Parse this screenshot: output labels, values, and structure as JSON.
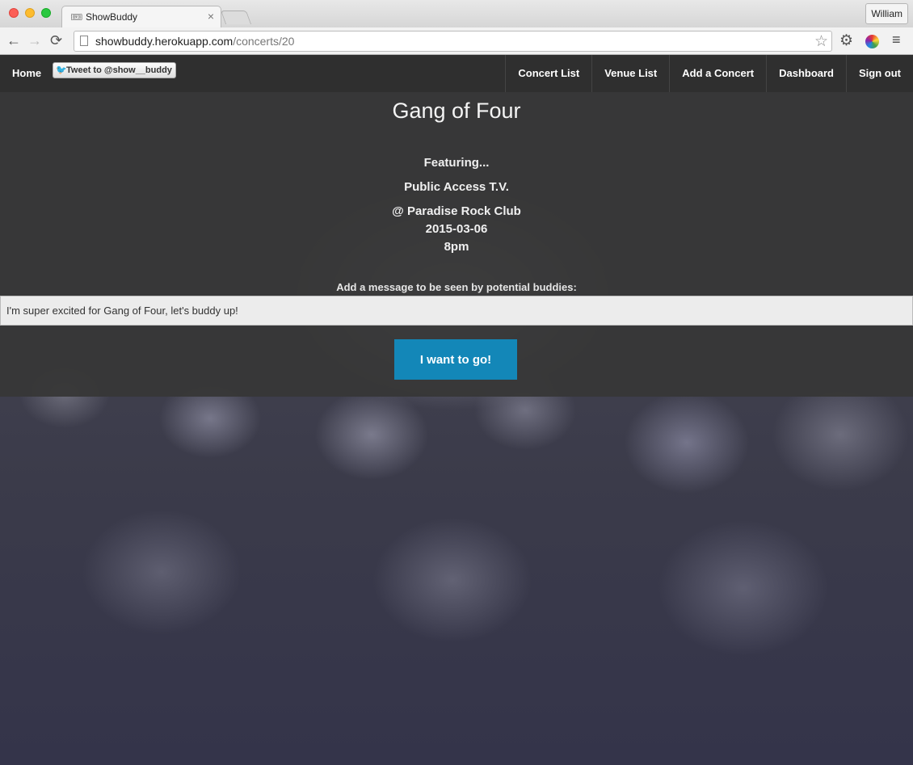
{
  "browser": {
    "tab_title": "ShowBuddy",
    "tab_close": "×",
    "profile_name": "William",
    "url_host": "showbuddy.herokuapp.com",
    "url_path": "/concerts/20",
    "icons": {
      "back": "←",
      "forward": "→",
      "reload": "⟳",
      "star": "☆",
      "settings": "⚙",
      "menu": "≡",
      "favicon": "🎟"
    }
  },
  "navbar": {
    "home": "Home",
    "tweet_label": "Tweet to @show__buddy",
    "tweet_icon": "🐦",
    "items": [
      "Concert List",
      "Venue List",
      "Add a Concert",
      "Dashboard",
      "Sign out"
    ]
  },
  "concert": {
    "title": "Gang of Four",
    "featuring_label": "Featuring...",
    "opener": "Public Access T.V.",
    "venue": "@ Paradise Rock Club",
    "date": "2015-03-06",
    "time": "8pm"
  },
  "form": {
    "message_label": "Add a message to be seen by potential buddies:",
    "message_value": "I'm super excited for Gang of Four, let's buddy up!",
    "submit_label": "I want to go!"
  },
  "colors": {
    "navbar": "#2f2f2f",
    "button": "#1387b8"
  }
}
